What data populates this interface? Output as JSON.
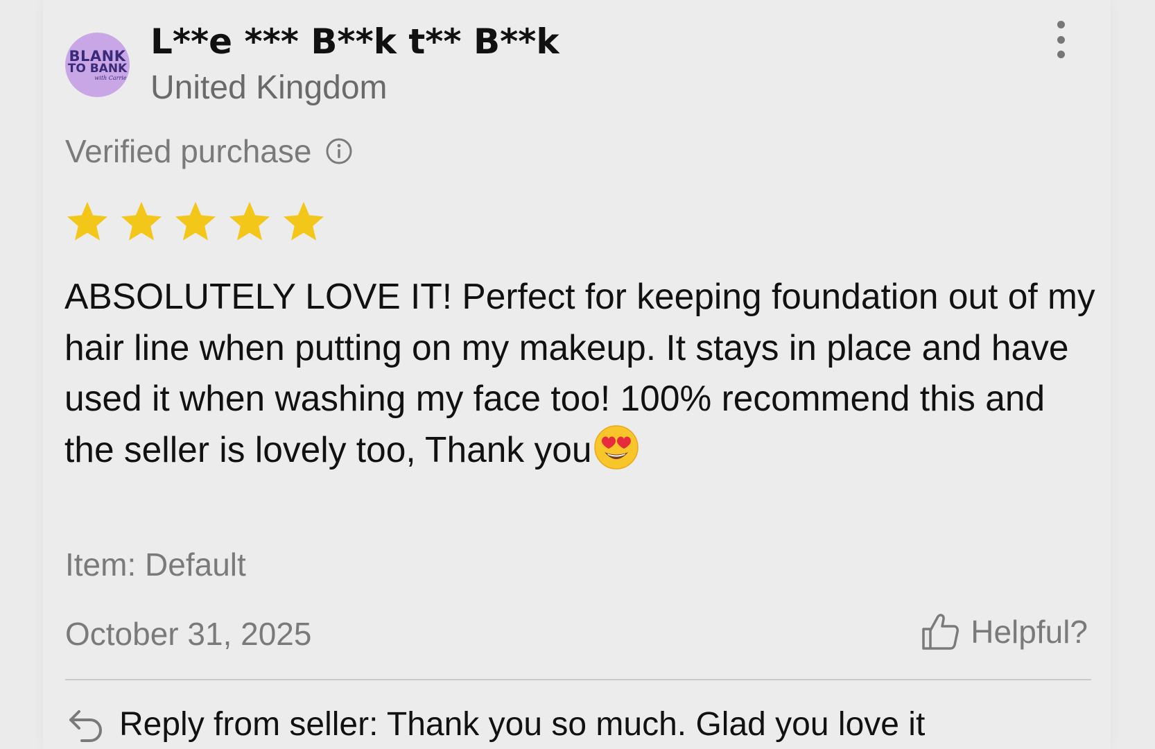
{
  "reviewer": {
    "avatar": {
      "line1": "BLANK",
      "line2": "TO BANK",
      "script": "with Carrie"
    },
    "name": "L**e *** B**k t** B**k",
    "country": "United Kingdom"
  },
  "review": {
    "verified_label": "Verified purchase",
    "rating": 5,
    "rating_max": 5,
    "star_color": "#f2c71a",
    "text": "ABSOLUTELY LOVE IT! Perfect for keeping foundation out of my hair line when putting on my makeup. It stays in place and have used it when washing my face too! 100% recommend this and the seller is lovely too, Thank you",
    "emoji": "heart-eyes-emoji",
    "item": "Item: Default",
    "date": "October 31, 2025",
    "helpful_label": "Helpful?"
  },
  "seller_reply": {
    "text": "Reply from seller: Thank you so much. Glad you love it"
  },
  "icons": {
    "more": "more-vertical-icon",
    "info": "info-icon",
    "star": "star-icon",
    "thumb": "thumbs-up-icon",
    "reply": "reply-arrow-icon"
  }
}
